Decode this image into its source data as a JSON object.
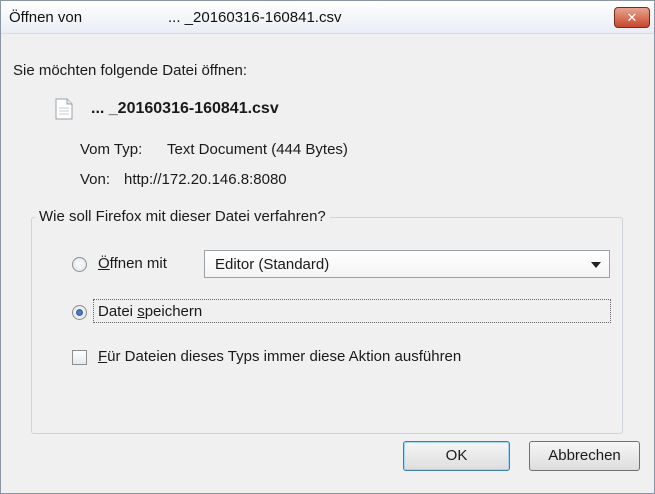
{
  "window": {
    "title_prefix": "Öffnen von",
    "title_filename": "... _20160316-160841.csv",
    "close_label": "✕"
  },
  "dialog": {
    "prompt": "Sie möchten folgende Datei öffnen:",
    "file_icon": "document-icon",
    "file_name": "...  _20160316-160841.csv",
    "type_label": "Vom Typ:",
    "type_value": "Text Document (444 Bytes)",
    "from_label": "Von:",
    "from_value": "http://172.20.146.8:8080"
  },
  "action_group": {
    "legend": "Wie soll Firefox mit dieser Datei verfahren?",
    "open_with": {
      "label_accel": "Ö",
      "label_rest": "ffnen mit",
      "selected": false,
      "app_value": "Editor (Standard)"
    },
    "save_file": {
      "label_pre": "Datei ",
      "label_accel": "s",
      "label_rest": "peichern",
      "selected": true
    },
    "always": {
      "label_accel": "F",
      "label_rest": "ür Dateien dieses Typs immer diese Aktion ausführen",
      "checked": false
    }
  },
  "buttons": {
    "ok": "OK",
    "cancel": "Abbrechen"
  }
}
